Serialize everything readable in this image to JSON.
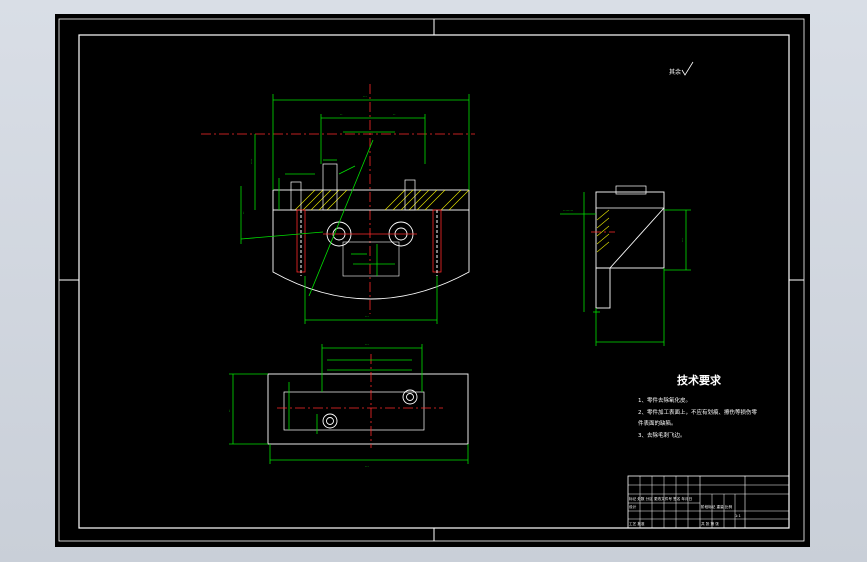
{
  "tech_requirements": {
    "title": "技术要求",
    "items": [
      "1、零件去除氧化皮。",
      "2、零件加工表面上，不应有划痕、擦伤等损伤零",
      "件表面的缺陷。",
      "3、去除毛刺飞边。"
    ]
  },
  "roughness_note": "其余",
  "title_block": {
    "rows": [
      "更改文件号",
      "标记  处数  分区  更改文件号  签名  年月日",
      "设计",
      "审核",
      "工艺  批准"
    ],
    "right_labels": [
      "阶段标记  重量  比例",
      "1:1",
      "共    张  第    张"
    ]
  },
  "colors": {
    "frame": "#ffffff",
    "dimension": "#00e000",
    "centerline": "#ff2a2a",
    "outline": "#ffffff",
    "hatch": "#e8e800"
  }
}
